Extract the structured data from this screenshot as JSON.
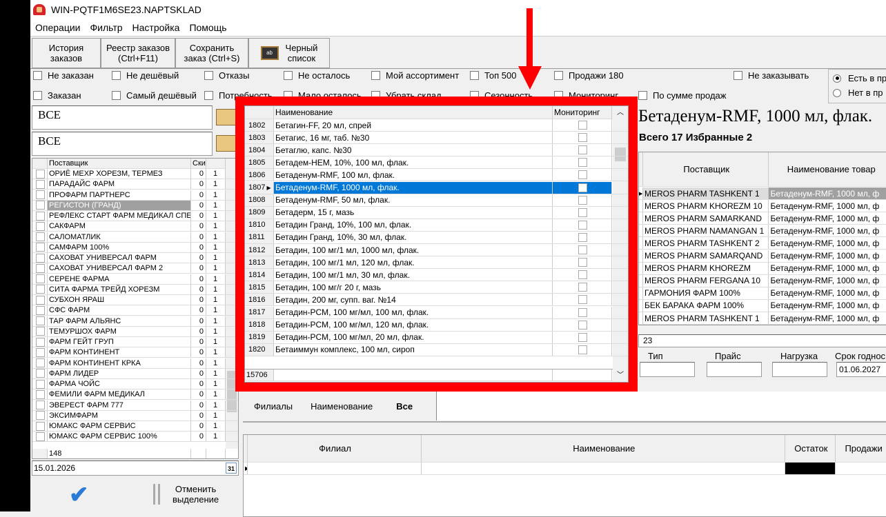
{
  "window": {
    "title": "WIN-PQTF1M6SE23.NAPTSKLAD"
  },
  "menu": [
    "Операции",
    "Фильтр",
    "Настройка",
    "Помощь"
  ],
  "toolbar": [
    "История\nзаказов",
    "Реестр заказов\n(Ctrl+F11)",
    "Сохранить\nзаказ (Ctrl+S)",
    "Черный\nсписок"
  ],
  "filters_row1": [
    "Не заказан",
    "Не дешёвый",
    "Отказы",
    "Не осталось",
    "Мой ассортимент",
    "Топ 500",
    "Продажи 180",
    "Не заказывать"
  ],
  "filters_row2": [
    "Заказан",
    "Самый дешёвый",
    "Потребность",
    "Мало осталось",
    "Убрать склад",
    "Сезонность",
    "Мониторинг",
    "По сумме продаж"
  ],
  "radios": [
    "Есть в пр",
    "Нет в пр"
  ],
  "left": {
    "filter1": "ВСЕ",
    "filter2": "ВСЕ",
    "headers": [
      "Поставщик",
      "Ски"
    ],
    "suppliers": [
      "ОРИЁ МЕХР ХОРЕЗМ, ТЕРМЕЗ",
      "ПАРАДАЙС ФАРМ",
      "ПРОФАРМ ПАРТНЕРС",
      "РЕГИСТОН (ГРАНД)",
      "РЕФЛЕКС СТАРТ ФАРМ МЕДИКАЛ СПЕЦ",
      "САКФАРМ",
      "САЛОМАТЛИК",
      "САМФАРМ 100%",
      "САХОВАТ УНИВЕРСАЛ ФАРМ",
      "САХОВАТ УНИВЕРСАЛ ФАРМ 2",
      "СЕРЕНЕ ФАРМА",
      "СИТА ФАРМА ТРЕЙД ХОРЕЗМ",
      "СУБХОН ЯРАШ",
      "СФС ФАРМ",
      "ТАР ФАРМ АЛЬЯНС",
      "ТЕМУРШОХ ФАРМ",
      "ФАРМ ГЕЙТ ГРУП",
      "ФАРМ КОНТИНЕНТ",
      "ФАРМ КОНТИНЕНТ КРКА",
      "ФАРМ ЛИДЕР",
      "ФАРМА ЧОЙС",
      "ФЕМИЛИ ФАРМ МЕДИКАЛ",
      "ЭВЕРЕСТ ФАРМ 777",
      "ЭКСИМФАРМ",
      "ЮМАКС ФАРМ СЕРВИС",
      "ЮМАКС ФАРМ СЕРВИС 100%"
    ],
    "col_a": "0",
    "col_b": "1",
    "selected": 3,
    "count": "148",
    "date": "15.01.2026",
    "calendar": "31",
    "cancel_label": "Отменить\nвыделение"
  },
  "popup": {
    "headers": [
      "Наименование",
      "Мониторинг"
    ],
    "selected": 5,
    "count": "15706",
    "rows": [
      [
        "1802",
        "Бетагин-FF, 20 мл, спрей"
      ],
      [
        "1803",
        "Бетагис, 16 мг, таб. №30"
      ],
      [
        "1804",
        "Бетаглю, капс. №30"
      ],
      [
        "1805",
        "Бетадем-НЕМ, 10%, 100 мл, флак."
      ],
      [
        "1806",
        "Бетаденум-RMF, 100 мл, флак."
      ],
      [
        "1807",
        "Бетаденум-RMF, 1000 мл, флак."
      ],
      [
        "1808",
        "Бетаденум-RMF, 50 мл, флак."
      ],
      [
        "1809",
        "Бетадерм, 15 г, мазь"
      ],
      [
        "1810",
        "Бетадин Гранд, 10%, 100 мл, флак."
      ],
      [
        "1811",
        "Бетадин Гранд, 10%, 30 мл, флак."
      ],
      [
        "1812",
        "Бетадин, 100 мг/1 мл, 1000 мл, флак."
      ],
      [
        "1813",
        "Бетадин, 100 мг/1 мл, 120 мл, флак."
      ],
      [
        "1814",
        "Бетадин, 100 мг/1 мл, 30 мл, флак."
      ],
      [
        "1815",
        "Бетадин, 100 мг/г 20 г, мазь"
      ],
      [
        "1816",
        "Бетадин, 200 мг, супп. ваг. №14"
      ],
      [
        "1817",
        "Бетадин-PCM, 100 мг/мл, 100 мл, флак."
      ],
      [
        "1818",
        "Бетадин-PCM, 100 мг/мл, 120 мл, флак."
      ],
      [
        "1819",
        "Бетадин-PCM, 100 мг/мл, 20 мл, флак."
      ],
      [
        "1820",
        "Бетаиммун комплекс, 100 мл, сироп"
      ]
    ]
  },
  "right": {
    "product": "Бетаденум-RMF, 1000 мл, флак.",
    "summary": "Всего 17 Избранные 2",
    "headers": [
      "Поставщик",
      "Наименование товар"
    ],
    "rows": [
      "MEROS PHARM TASHKENT 1",
      "MEROS PHARM KHOREZM 10",
      "MEROS PHARM SAMARKAND",
      "MEROS PHARM NAMANGAN 1",
      "MEROS PHARM TASHKENT 2",
      "MEROS PHARM SAMARQAND",
      "MEROS PHARM KHOREZM",
      "MEROS PHARM FERGANA 10",
      "ГАРМОНИЯ ФАРМ 100%",
      "БЕК БАРАКА ФАРМ 100%",
      "MEROS PHARM TASHKENT 1"
    ],
    "row_product": "Бетаденум-RMF, 1000 мл, ф",
    "count": "23",
    "fields": [
      "Тип",
      "Прайс",
      "Нагрузка",
      "Срок годнос"
    ],
    "expiry": "01.06.2027"
  },
  "bottom": {
    "tabs": [
      "Филиалы",
      "Наименование",
      "Все"
    ],
    "headers": [
      "Филиал",
      "Наименование",
      "Остаток",
      "Продажи"
    ]
  },
  "colors": {
    "highlight": "#0078d7",
    "annotation": "#ff0000"
  }
}
